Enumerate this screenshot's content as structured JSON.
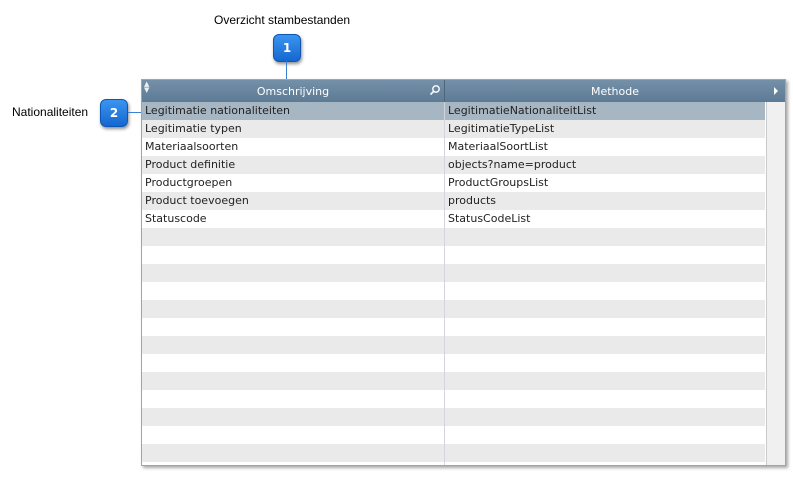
{
  "callouts": {
    "c1": {
      "number": "1",
      "text": "Overzicht stambestanden"
    },
    "c2": {
      "number": "2",
      "text": "Nationaliteiten"
    }
  },
  "grid": {
    "columns": [
      "Omschrijving",
      "Methode"
    ],
    "rows": [
      [
        "Legitimatie nationaliteiten",
        "LegitimatieNationaliteitList"
      ],
      [
        "Legitimatie typen",
        "LegitimatieTypeList"
      ],
      [
        "Materiaalsoorten",
        "MateriaalSoortList"
      ],
      [
        "Product definitie",
        "objects?name=product"
      ],
      [
        "Productgroepen",
        "ProductGroupsList"
      ],
      [
        "Product toevoegen",
        "products"
      ],
      [
        "Statuscode",
        "StatusCodeList"
      ]
    ],
    "selected_row": 0
  },
  "colors": {
    "header": "#6a879f",
    "selected": "#a7b6c3",
    "badge": "#1f7ae0"
  },
  "icons": {
    "sort": "sort-arrows-icon",
    "search": "magnifier-icon",
    "column_menu": "arrow-right-icon"
  }
}
